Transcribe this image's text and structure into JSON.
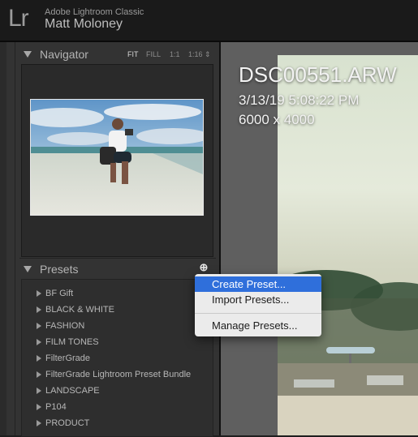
{
  "app": {
    "logo": "Lr",
    "name": "Adobe Lightroom Classic",
    "user": "Matt Moloney"
  },
  "navigator": {
    "title": "Navigator",
    "zoom_options": [
      "FIT",
      "FILL",
      "1:1",
      "1:16 ⇕"
    ],
    "active_zoom": "FIT"
  },
  "presets": {
    "title": "Presets",
    "items": [
      "BF Gift",
      "BLACK & WHITE",
      "FASHION",
      "FILM TONES",
      "FilterGrade",
      "FilterGrade Lightroom Preset Bundle",
      "LANDSCAPE",
      "P104",
      "PRODUCT"
    ]
  },
  "photo_info": {
    "filename": "DSC00551.ARW",
    "datetime": "3/13/19 5:08:22 PM",
    "dimensions": "6000 x 4000"
  },
  "context_menu": {
    "items": [
      "Create Preset...",
      "Import Presets...",
      "Manage Presets..."
    ],
    "highlighted": "Create Preset..."
  },
  "colors": {
    "menu_highlight": "#2f6fdb",
    "panel_bg": "#333333"
  }
}
